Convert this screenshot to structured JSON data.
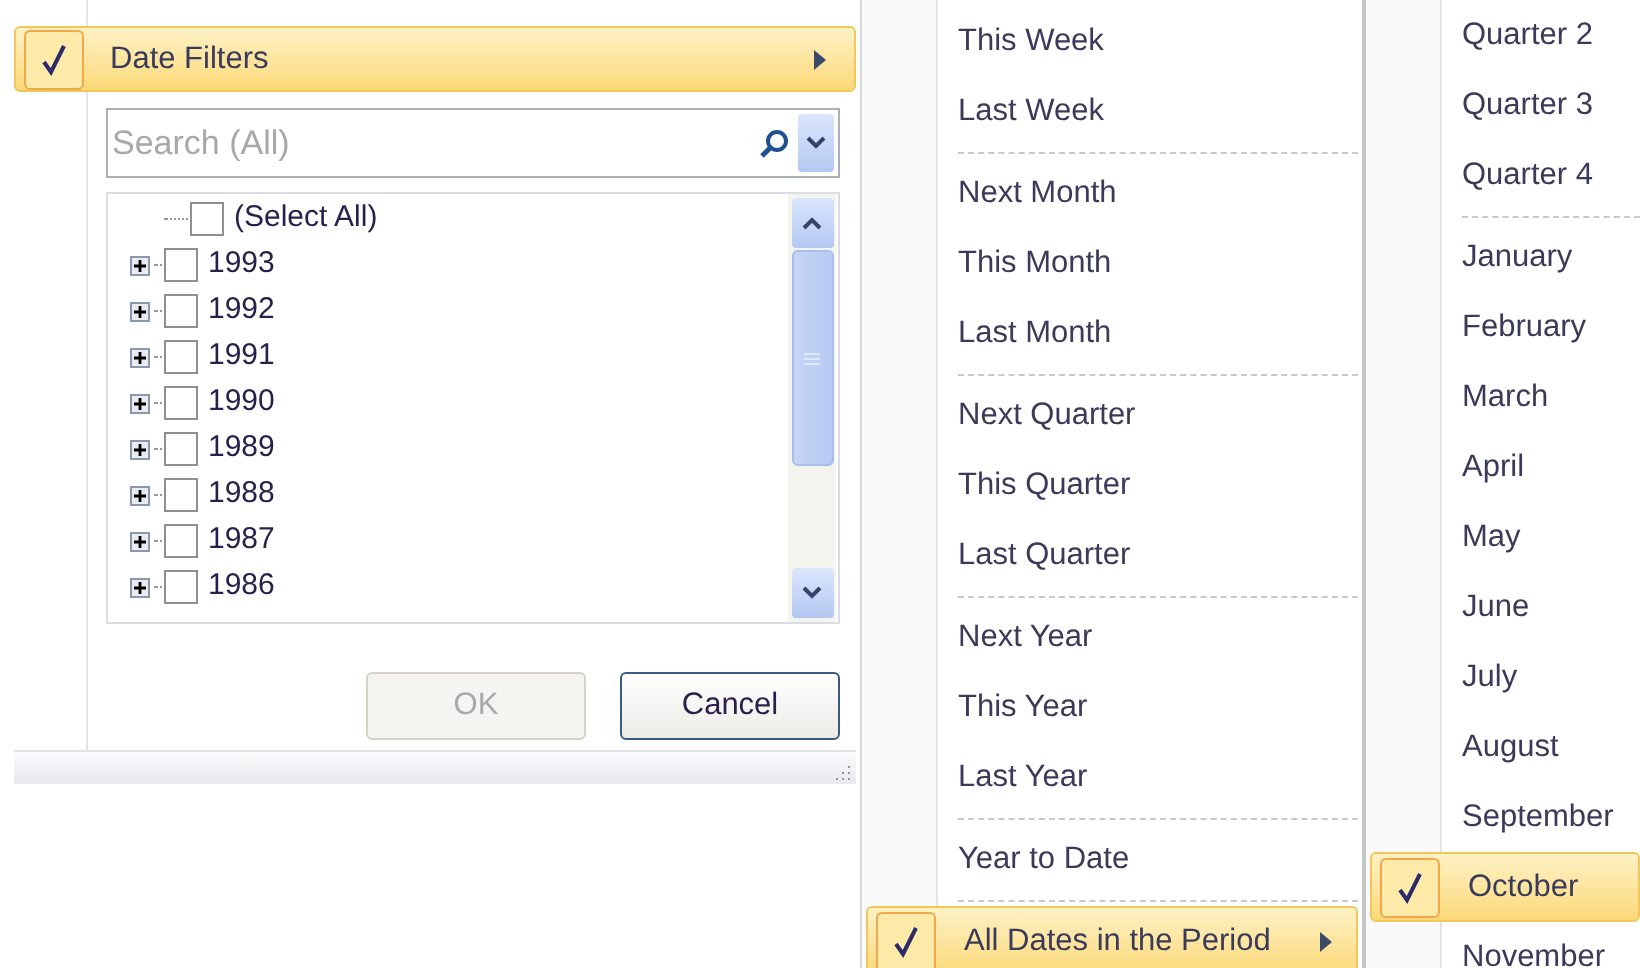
{
  "filter_panel": {
    "menu_item": {
      "label": "Date Filters",
      "checked": true,
      "selected": true,
      "submenu": true
    },
    "search": {
      "placeholder": "Search (All)"
    },
    "tree": {
      "items": [
        {
          "kind": "select_all",
          "label": "(Select All)",
          "checked": false
        },
        {
          "kind": "year",
          "label": "1993",
          "checked": false,
          "expanded": false
        },
        {
          "kind": "year",
          "label": "1992",
          "checked": false,
          "expanded": false
        },
        {
          "kind": "year",
          "label": "1991",
          "checked": false,
          "expanded": false
        },
        {
          "kind": "year",
          "label": "1990",
          "checked": false,
          "expanded": false
        },
        {
          "kind": "year",
          "label": "1989",
          "checked": false,
          "expanded": false
        },
        {
          "kind": "year",
          "label": "1988",
          "checked": false,
          "expanded": false
        },
        {
          "kind": "year",
          "label": "1987",
          "checked": false,
          "expanded": false
        },
        {
          "kind": "year",
          "label": "1986",
          "checked": false,
          "expanded": false
        }
      ]
    },
    "buttons": [
      {
        "label": "OK",
        "disabled": true
      },
      {
        "label": "Cancel",
        "disabled": false
      }
    ]
  },
  "date_menu": {
    "items": [
      {
        "kind": "item",
        "label": "This Week",
        "checked": false,
        "selected": false,
        "submenu": false
      },
      {
        "kind": "item",
        "label": "Last Week",
        "checked": false,
        "selected": false,
        "submenu": false
      },
      {
        "kind": "separator"
      },
      {
        "kind": "item",
        "label": "Next Month",
        "checked": false,
        "selected": false,
        "submenu": false
      },
      {
        "kind": "item",
        "label": "This Month",
        "checked": false,
        "selected": false,
        "submenu": false
      },
      {
        "kind": "item",
        "label": "Last Month",
        "checked": false,
        "selected": false,
        "submenu": false
      },
      {
        "kind": "separator"
      },
      {
        "kind": "item",
        "label": "Next Quarter",
        "checked": false,
        "selected": false,
        "submenu": false
      },
      {
        "kind": "item",
        "label": "This Quarter",
        "checked": false,
        "selected": false,
        "submenu": false
      },
      {
        "kind": "item",
        "label": "Last Quarter",
        "checked": false,
        "selected": false,
        "submenu": false
      },
      {
        "kind": "separator"
      },
      {
        "kind": "item",
        "label": "Next Year",
        "checked": false,
        "selected": false,
        "submenu": false
      },
      {
        "kind": "item",
        "label": "This Year",
        "checked": false,
        "selected": false,
        "submenu": false
      },
      {
        "kind": "item",
        "label": "Last Year",
        "checked": false,
        "selected": false,
        "submenu": false
      },
      {
        "kind": "separator"
      },
      {
        "kind": "item",
        "label": "Year to Date",
        "checked": false,
        "selected": false,
        "submenu": false
      },
      {
        "kind": "separator"
      },
      {
        "kind": "item",
        "label": "All Dates in the Period",
        "checked": true,
        "selected": true,
        "submenu": true
      }
    ]
  },
  "period_menu": {
    "items": [
      {
        "kind": "item",
        "label": "Quarter 2",
        "checked": false,
        "selected": false
      },
      {
        "kind": "item",
        "label": "Quarter 3",
        "checked": false,
        "selected": false
      },
      {
        "kind": "item",
        "label": "Quarter 4",
        "checked": false,
        "selected": false
      },
      {
        "kind": "separator"
      },
      {
        "kind": "item",
        "label": "January",
        "checked": false,
        "selected": false
      },
      {
        "kind": "item",
        "label": "February",
        "checked": false,
        "selected": false
      },
      {
        "kind": "item",
        "label": "March",
        "checked": false,
        "selected": false
      },
      {
        "kind": "item",
        "label": "April",
        "checked": false,
        "selected": false
      },
      {
        "kind": "item",
        "label": "May",
        "checked": false,
        "selected": false
      },
      {
        "kind": "item",
        "label": "June",
        "checked": false,
        "selected": false
      },
      {
        "kind": "item",
        "label": "July",
        "checked": false,
        "selected": false
      },
      {
        "kind": "item",
        "label": "August",
        "checked": false,
        "selected": false
      },
      {
        "kind": "item",
        "label": "September",
        "checked": false,
        "selected": false
      },
      {
        "kind": "item",
        "label": "October",
        "checked": true,
        "selected": true
      },
      {
        "kind": "item",
        "label": "November",
        "checked": false,
        "selected": false
      }
    ]
  }
}
